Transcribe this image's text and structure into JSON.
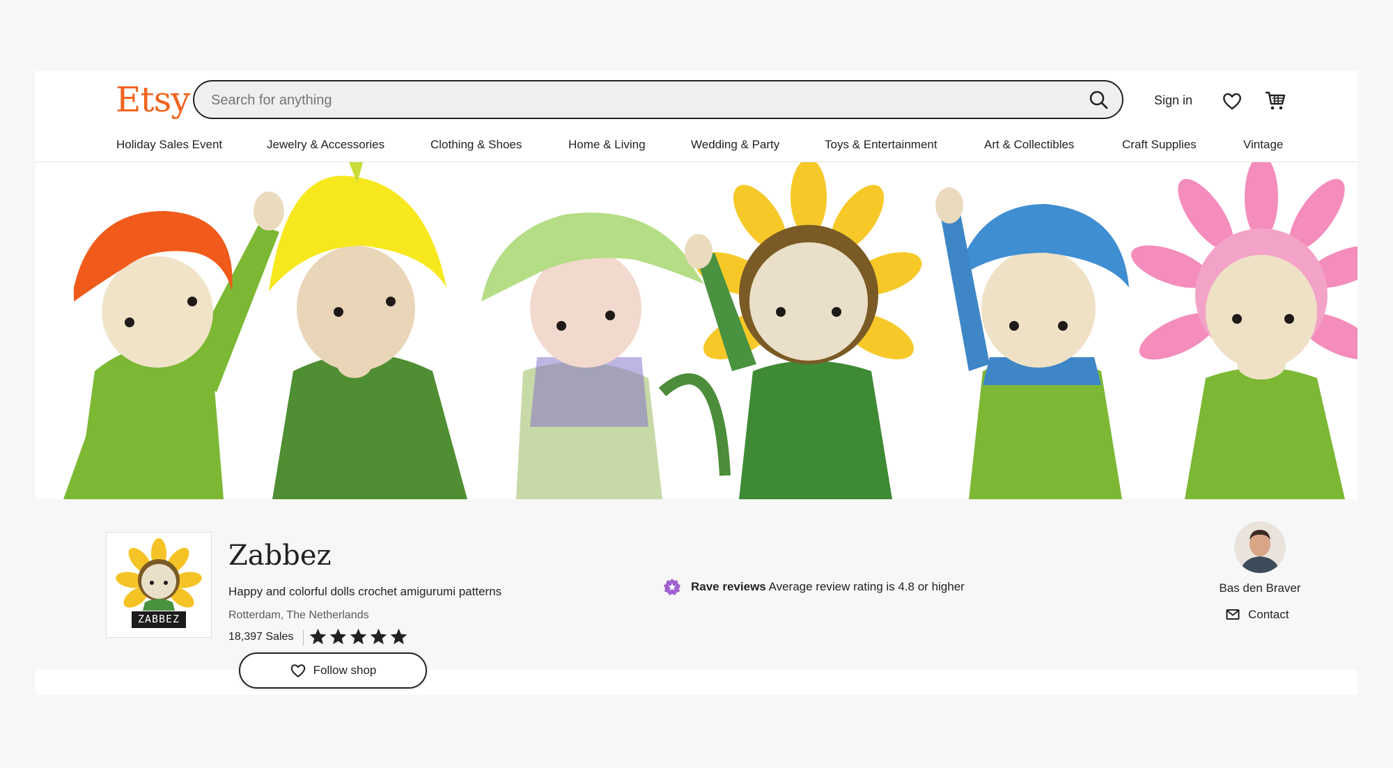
{
  "header": {
    "logo": "Etsy",
    "search_placeholder": "Search for anything",
    "signin_label": "Sign in"
  },
  "nav": [
    {
      "label": "Holiday Sales Event"
    },
    {
      "label": "Jewelry & Accessories"
    },
    {
      "label": "Clothing & Shoes"
    },
    {
      "label": "Home & Living"
    },
    {
      "label": "Wedding & Party"
    },
    {
      "label": "Toys & Entertainment"
    },
    {
      "label": "Art & Collectibles"
    },
    {
      "label": "Craft Supplies"
    },
    {
      "label": "Vintage"
    }
  ],
  "shop": {
    "logo_text": "ZABBEZ",
    "name": "Zabbez",
    "tagline": "Happy and colorful dolls crochet amigurumi patterns",
    "location": "Rotterdam, The Netherlands",
    "sales": "18,397 Sales",
    "rating_stars": 5,
    "follow_label": "Follow shop"
  },
  "badge": {
    "title": "Rave reviews",
    "description": "Average review rating is 4.8 or higher"
  },
  "owner": {
    "name": "Bas den Braver",
    "contact_label": "Contact"
  },
  "colors": {
    "brand": "#f1641e",
    "badge": "#a061d1"
  }
}
